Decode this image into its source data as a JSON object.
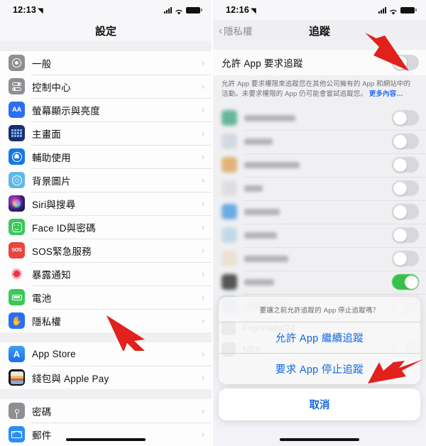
{
  "left_screen": {
    "status_bar": {
      "time": "12:13",
      "location_arrow": "➤",
      "signal_icon": "cellular-bars",
      "wifi_icon": "wifi",
      "battery_icon": "battery-full"
    },
    "nav_title": "設定",
    "groups": [
      {
        "items": [
          {
            "label": "一般",
            "icon": "gear-icon"
          },
          {
            "label": "控制中心",
            "icon": "control-center-icon"
          },
          {
            "label": "螢幕顯示與亮度",
            "icon": "display-brightness-icon"
          },
          {
            "label": "主畫面",
            "icon": "home-screen-icon"
          },
          {
            "label": "輔助使用",
            "icon": "accessibility-icon"
          },
          {
            "label": "背景圖片",
            "icon": "wallpaper-icon"
          },
          {
            "label": "Siri與搜尋",
            "icon": "siri-icon"
          },
          {
            "label": "Face ID與密碼",
            "icon": "face-id-icon"
          },
          {
            "label": "SOS緊急服務",
            "icon": "sos-icon"
          },
          {
            "label": "暴露通知",
            "icon": "exposure-notification-icon"
          },
          {
            "label": "電池",
            "icon": "battery-icon"
          },
          {
            "label": "隱私權",
            "icon": "privacy-hand-icon"
          }
        ]
      },
      {
        "items": [
          {
            "label": "App Store",
            "icon": "app-store-icon"
          },
          {
            "label": "錢包與 Apple Pay",
            "icon": "wallet-icon"
          }
        ]
      },
      {
        "items": [
          {
            "label": "密碼",
            "icon": "passwords-key-icon"
          },
          {
            "label": "郵件",
            "icon": "mail-icon"
          }
        ]
      }
    ],
    "chevron": "›",
    "annotation_arrow": "red-arrow-pointing-to-privacy"
  },
  "right_screen": {
    "status_bar": {
      "time": "12:16",
      "location_arrow": "➤",
      "signal_icon": "cellular-bars",
      "wifi_icon": "wifi",
      "battery_icon": "battery-full"
    },
    "nav_back_label": "隱私權",
    "nav_back_chevron": "‹",
    "nav_title": "追蹤",
    "main_toggle": {
      "label": "允許 App 要求追蹤",
      "state": "off"
    },
    "footnote": "允許 App 要求權限來追蹤您在其他公司擁有的 App 和網站中的活動。未要求權限的 App 仍可能會嘗試追蹤您。",
    "footnote_more": "更多內容…",
    "blurred_apps": [
      {
        "icon_color": "#4cae8a",
        "name_width": 72,
        "toggle": "off"
      },
      {
        "icon_color": "#cfd6dd",
        "name_width": 40,
        "toggle": "off"
      },
      {
        "icon_color": "#e0a964",
        "name_width": 78,
        "toggle": "off"
      },
      {
        "icon_color": "#dcdce0",
        "name_width": 26,
        "toggle": "off"
      },
      {
        "icon_color": "#56a0e0",
        "name_width": 50,
        "toggle": "off"
      },
      {
        "icon_color": "#bcd6e6",
        "name_width": 46,
        "toggle": "off"
      },
      {
        "icon_color": "#eadfcb",
        "name_width": 62,
        "toggle": "off"
      },
      {
        "icon_color": "#3a3a3c",
        "name_width": 42,
        "toggle": "on"
      },
      {
        "icon_color": "#6f9fd0",
        "name_width": 66,
        "toggle": "off"
      }
    ],
    "partial_app_behind_sheet": "Flightradar24",
    "bottom_app": {
      "name": "NBA",
      "toggle": "off"
    },
    "action_sheet": {
      "title": "要讓之前允許追蹤的 App 停止追蹤嗎？",
      "options": [
        "允許 App 繼續追蹤",
        "要求 App 停止追蹤"
      ],
      "cancel": "取消"
    },
    "annotation_arrow_top": "red-arrow-pointing-to-allow-toggle",
    "annotation_arrow_bottom": "red-arrow-pointing-to-ask-apps-to-stop"
  },
  "colors": {
    "accent_blue": "#2b6ef6",
    "link_blue": "#1068e0",
    "toggle_on_green": "#36c24a",
    "toggle_off_gray": "#d8d8dc",
    "arrow_red": "#e2201c",
    "list_bg": "#fdfdfd",
    "page_bg": "#f0f0f2"
  }
}
